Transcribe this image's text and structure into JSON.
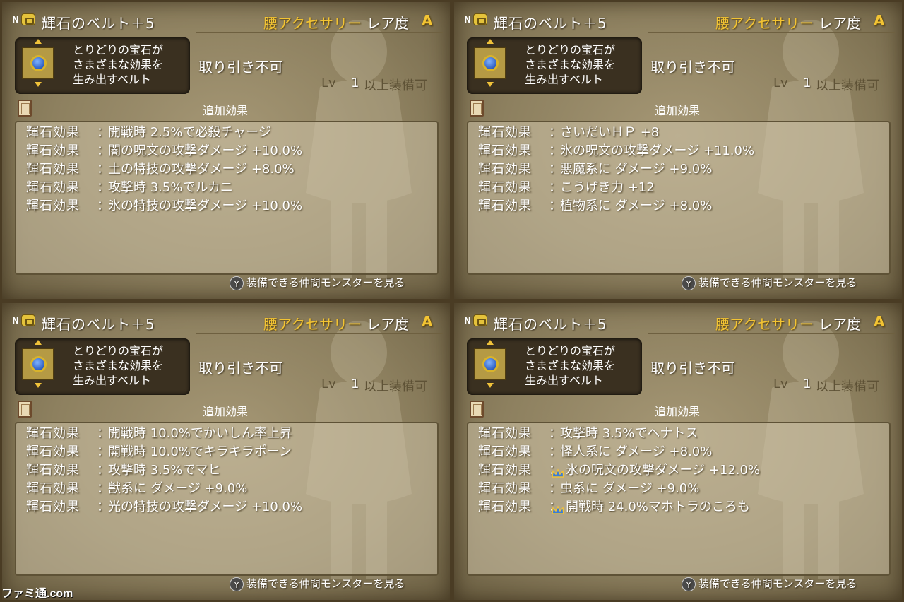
{
  "colors": {
    "gold": "#f3c433",
    "panel": "#9a8c6a",
    "text": "#ffffff"
  },
  "watermark": "ファミ通.com",
  "panels": [
    {
      "header": {
        "n_badge": "N",
        "item_name": "輝石のベルト＋5",
        "category": "腰アクセサリー",
        "rarity_label": "レア度",
        "rarity_value": "A"
      },
      "description": "とりどりの宝石が\nさまざまな効果を\n生み出すベルト",
      "trade": "取り引き不可",
      "level": {
        "label": "Lv",
        "value": "1",
        "suffix": "以上装備可"
      },
      "additional_effects_title": "追加効果",
      "effects": [
        {
          "label": "輝石効果",
          "sep": "：",
          "text": "開戦時 2.5%で必殺チャージ",
          "crown": false
        },
        {
          "label": "輝石効果",
          "sep": "：",
          "text": "闇の呪文の攻撃ダメージ +10.0%",
          "crown": false
        },
        {
          "label": "輝石効果",
          "sep": "：",
          "text": "土の特技の攻撃ダメージ +8.0%",
          "crown": false
        },
        {
          "label": "輝石効果",
          "sep": "：",
          "text": "攻撃時 3.5%でルカニ",
          "crown": false
        },
        {
          "label": "輝石効果",
          "sep": "：",
          "text": "氷の特技の攻撃ダメージ +10.0%",
          "crown": false
        }
      ],
      "footer": {
        "button": "Y",
        "text": "装備できる仲間モンスターを見る"
      }
    },
    {
      "header": {
        "n_badge": "N",
        "item_name": "輝石のベルト＋5",
        "category": "腰アクセサリー",
        "rarity_label": "レア度",
        "rarity_value": "A"
      },
      "description": "とりどりの宝石が\nさまざまな効果を\n生み出すベルト",
      "trade": "取り引き不可",
      "level": {
        "label": "Lv",
        "value": "1",
        "suffix": "以上装備可"
      },
      "additional_effects_title": "追加効果",
      "effects": [
        {
          "label": "輝石効果",
          "sep": "：",
          "text": "さいだいＨＰ +8",
          "crown": false
        },
        {
          "label": "輝石効果",
          "sep": "：",
          "text": "氷の呪文の攻撃ダメージ +11.0%",
          "crown": false
        },
        {
          "label": "輝石効果",
          "sep": "：",
          "text": "悪魔系に ダメージ +9.0%",
          "crown": false
        },
        {
          "label": "輝石効果",
          "sep": "：",
          "text": "こうげき力 +12",
          "crown": false
        },
        {
          "label": "輝石効果",
          "sep": "：",
          "text": "植物系に ダメージ +8.0%",
          "crown": false
        }
      ],
      "footer": {
        "button": "Y",
        "text": "装備できる仲間モンスターを見る"
      }
    },
    {
      "header": {
        "n_badge": "N",
        "item_name": "輝石のベルト＋5",
        "category": "腰アクセサリー",
        "rarity_label": "レア度",
        "rarity_value": "A"
      },
      "description": "とりどりの宝石が\nさまざまな効果を\n生み出すベルト",
      "trade": "取り引き不可",
      "level": {
        "label": "Lv",
        "value": "1",
        "suffix": "以上装備可"
      },
      "additional_effects_title": "追加効果",
      "effects": [
        {
          "label": "輝石効果",
          "sep": "：",
          "text": "開戦時 10.0%でかいしん率上昇",
          "crown": false
        },
        {
          "label": "輝石効果",
          "sep": "：",
          "text": "開戦時 10.0%でキラキラポーン",
          "crown": false
        },
        {
          "label": "輝石効果",
          "sep": "：",
          "text": "攻撃時 3.5%でマヒ",
          "crown": false
        },
        {
          "label": "輝石効果",
          "sep": "：",
          "text": "獣系に ダメージ +9.0%",
          "crown": false
        },
        {
          "label": "輝石効果",
          "sep": "：",
          "text": "光の特技の攻撃ダメージ +10.0%",
          "crown": false
        }
      ],
      "footer": {
        "button": "Y",
        "text": "装備できる仲間モンスターを見る"
      }
    },
    {
      "header": {
        "n_badge": "N",
        "item_name": "輝石のベルト＋5",
        "category": "腰アクセサリー",
        "rarity_label": "レア度",
        "rarity_value": "A"
      },
      "description": "とりどりの宝石が\nさまざまな効果を\n生み出すベルト",
      "trade": "取り引き不可",
      "level": {
        "label": "Lv",
        "value": "1",
        "suffix": "以上装備可"
      },
      "additional_effects_title": "追加効果",
      "effects": [
        {
          "label": "輝石効果",
          "sep": "：",
          "text": "攻撃時 3.5%でヘナトス",
          "crown": false
        },
        {
          "label": "輝石効果",
          "sep": "：",
          "text": "怪人系に ダメージ +8.0%",
          "crown": false
        },
        {
          "label": "輝石効果",
          "sep": "：",
          "text": "氷の呪文の攻撃ダメージ +12.0%",
          "crown": true
        },
        {
          "label": "輝石効果",
          "sep": "：",
          "text": "虫系に ダメージ +9.0%",
          "crown": false
        },
        {
          "label": "輝石効果",
          "sep": "：",
          "text": "開戦時 24.0%マホトラのころも",
          "crown": true
        }
      ],
      "footer": {
        "button": "Y",
        "text": "装備できる仲間モンスターを見る"
      }
    }
  ]
}
